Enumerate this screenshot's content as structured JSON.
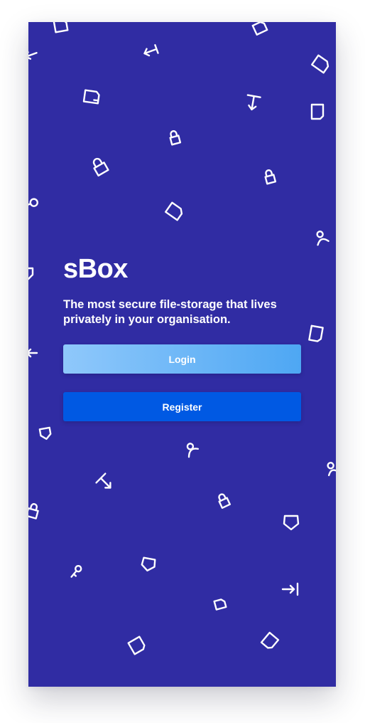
{
  "app": {
    "name": "sBox",
    "tagline": "The most secure file-storage that lives privately in your organisation."
  },
  "actions": {
    "login_label": "Login",
    "register_label": "Register"
  },
  "theme": {
    "background": "#302ca3",
    "login_gradient_start": "#8fc8fb",
    "login_gradient_end": "#4ea7f3",
    "register_color": "#0059e3",
    "text_color": "#ffffff"
  },
  "decorations": {
    "icon_types": [
      "file-icon",
      "lock-icon",
      "key-icon",
      "arrow-icon",
      "shield-icon",
      "person-icon"
    ]
  }
}
